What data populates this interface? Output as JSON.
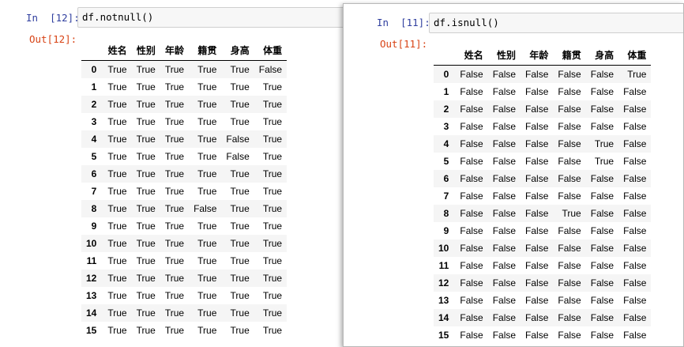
{
  "left_cell": {
    "in_prompt": "In  [12]:",
    "code": "df.notnull()",
    "out_prompt": "Out[12]:",
    "columns": [
      "姓名",
      "性别",
      "年龄",
      "籍贯",
      "身高",
      "体重"
    ],
    "rows": [
      {
        "index": "0",
        "values": [
          "True",
          "True",
          "True",
          "True",
          "True",
          "False"
        ]
      },
      {
        "index": "1",
        "values": [
          "True",
          "True",
          "True",
          "True",
          "True",
          "True"
        ]
      },
      {
        "index": "2",
        "values": [
          "True",
          "True",
          "True",
          "True",
          "True",
          "True"
        ]
      },
      {
        "index": "3",
        "values": [
          "True",
          "True",
          "True",
          "True",
          "True",
          "True"
        ]
      },
      {
        "index": "4",
        "values": [
          "True",
          "True",
          "True",
          "True",
          "False",
          "True"
        ]
      },
      {
        "index": "5",
        "values": [
          "True",
          "True",
          "True",
          "True",
          "False",
          "True"
        ]
      },
      {
        "index": "6",
        "values": [
          "True",
          "True",
          "True",
          "True",
          "True",
          "True"
        ]
      },
      {
        "index": "7",
        "values": [
          "True",
          "True",
          "True",
          "True",
          "True",
          "True"
        ]
      },
      {
        "index": "8",
        "values": [
          "True",
          "True",
          "True",
          "False",
          "True",
          "True"
        ]
      },
      {
        "index": "9",
        "values": [
          "True",
          "True",
          "True",
          "True",
          "True",
          "True"
        ]
      },
      {
        "index": "10",
        "values": [
          "True",
          "True",
          "True",
          "True",
          "True",
          "True"
        ]
      },
      {
        "index": "11",
        "values": [
          "True",
          "True",
          "True",
          "True",
          "True",
          "True"
        ]
      },
      {
        "index": "12",
        "values": [
          "True",
          "True",
          "True",
          "True",
          "True",
          "True"
        ]
      },
      {
        "index": "13",
        "values": [
          "True",
          "True",
          "True",
          "True",
          "True",
          "True"
        ]
      },
      {
        "index": "14",
        "values": [
          "True",
          "True",
          "True",
          "True",
          "True",
          "True"
        ]
      },
      {
        "index": "15",
        "values": [
          "True",
          "True",
          "True",
          "True",
          "True",
          "True"
        ]
      }
    ]
  },
  "right_cell": {
    "in_prompt": "In  [11]:",
    "code": "df.isnull()",
    "out_prompt": "Out[11]:",
    "columns": [
      "姓名",
      "性别",
      "年龄",
      "籍贯",
      "身高",
      "体重"
    ],
    "rows": [
      {
        "index": "0",
        "values": [
          "False",
          "False",
          "False",
          "False",
          "False",
          "True"
        ]
      },
      {
        "index": "1",
        "values": [
          "False",
          "False",
          "False",
          "False",
          "False",
          "False"
        ]
      },
      {
        "index": "2",
        "values": [
          "False",
          "False",
          "False",
          "False",
          "False",
          "False"
        ]
      },
      {
        "index": "3",
        "values": [
          "False",
          "False",
          "False",
          "False",
          "False",
          "False"
        ]
      },
      {
        "index": "4",
        "values": [
          "False",
          "False",
          "False",
          "False",
          "True",
          "False"
        ]
      },
      {
        "index": "5",
        "values": [
          "False",
          "False",
          "False",
          "False",
          "True",
          "False"
        ]
      },
      {
        "index": "6",
        "values": [
          "False",
          "False",
          "False",
          "False",
          "False",
          "False"
        ]
      },
      {
        "index": "7",
        "values": [
          "False",
          "False",
          "False",
          "False",
          "False",
          "False"
        ]
      },
      {
        "index": "8",
        "values": [
          "False",
          "False",
          "False",
          "True",
          "False",
          "False"
        ]
      },
      {
        "index": "9",
        "values": [
          "False",
          "False",
          "False",
          "False",
          "False",
          "False"
        ]
      },
      {
        "index": "10",
        "values": [
          "False",
          "False",
          "False",
          "False",
          "False",
          "False"
        ]
      },
      {
        "index": "11",
        "values": [
          "False",
          "False",
          "False",
          "False",
          "False",
          "False"
        ]
      },
      {
        "index": "12",
        "values": [
          "False",
          "False",
          "False",
          "False",
          "False",
          "False"
        ]
      },
      {
        "index": "13",
        "values": [
          "False",
          "False",
          "False",
          "False",
          "False",
          "False"
        ]
      },
      {
        "index": "14",
        "values": [
          "False",
          "False",
          "False",
          "False",
          "False",
          "False"
        ]
      },
      {
        "index": "15",
        "values": [
          "False",
          "False",
          "False",
          "False",
          "False",
          "False"
        ]
      }
    ]
  },
  "colors": {
    "in_prompt": "#303f9f",
    "out_prompt": "#d84315",
    "input_bg": "#f7f7f7",
    "stripe": "#f5f5f5"
  }
}
